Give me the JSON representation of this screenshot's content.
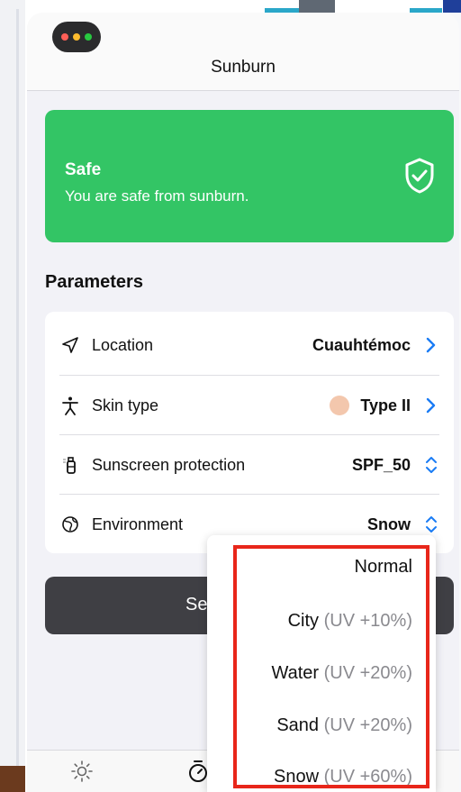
{
  "header": {
    "title": "Sunburn"
  },
  "status": {
    "title": "Safe",
    "message": "You are safe from sunburn.",
    "icon": "shield-check-icon",
    "color": "#33c565"
  },
  "parameters": {
    "section_title": "Parameters",
    "rows": [
      {
        "icon": "location-arrow-icon",
        "label": "Location",
        "value": "Cuauhtémoc",
        "control": "chevron-right-icon"
      },
      {
        "icon": "person-icon",
        "label": "Skin type",
        "value": "Type II",
        "control": "chevron-right-icon",
        "swatch": "#f3c7ad"
      },
      {
        "icon": "sunscreen-bottle-icon",
        "label": "Sunscreen protection",
        "value": "SPF_50",
        "control": "chevron-up-down-icon"
      },
      {
        "icon": "globe-icon",
        "label": "Environment",
        "value": "Snow",
        "control": "chevron-up-down-icon"
      }
    ]
  },
  "start_button": {
    "label": "Se"
  },
  "dropdown": {
    "options": [
      {
        "label": "Normal",
        "note": ""
      },
      {
        "label": "City",
        "note": "(UV +10%)"
      },
      {
        "label": "Water",
        "note": "(UV +20%)"
      },
      {
        "label": "Sand",
        "note": "(UV +20%)"
      },
      {
        "label": "Snow",
        "note": "(UV +60%)"
      }
    ],
    "highlight_color": "#e8261a"
  },
  "tabbar": {
    "tabs": [
      {
        "icon": "sun-icon"
      },
      {
        "icon": "timer-icon"
      }
    ]
  },
  "colors": {
    "accent": "#1a7cf5",
    "button": "#3f3f44"
  }
}
